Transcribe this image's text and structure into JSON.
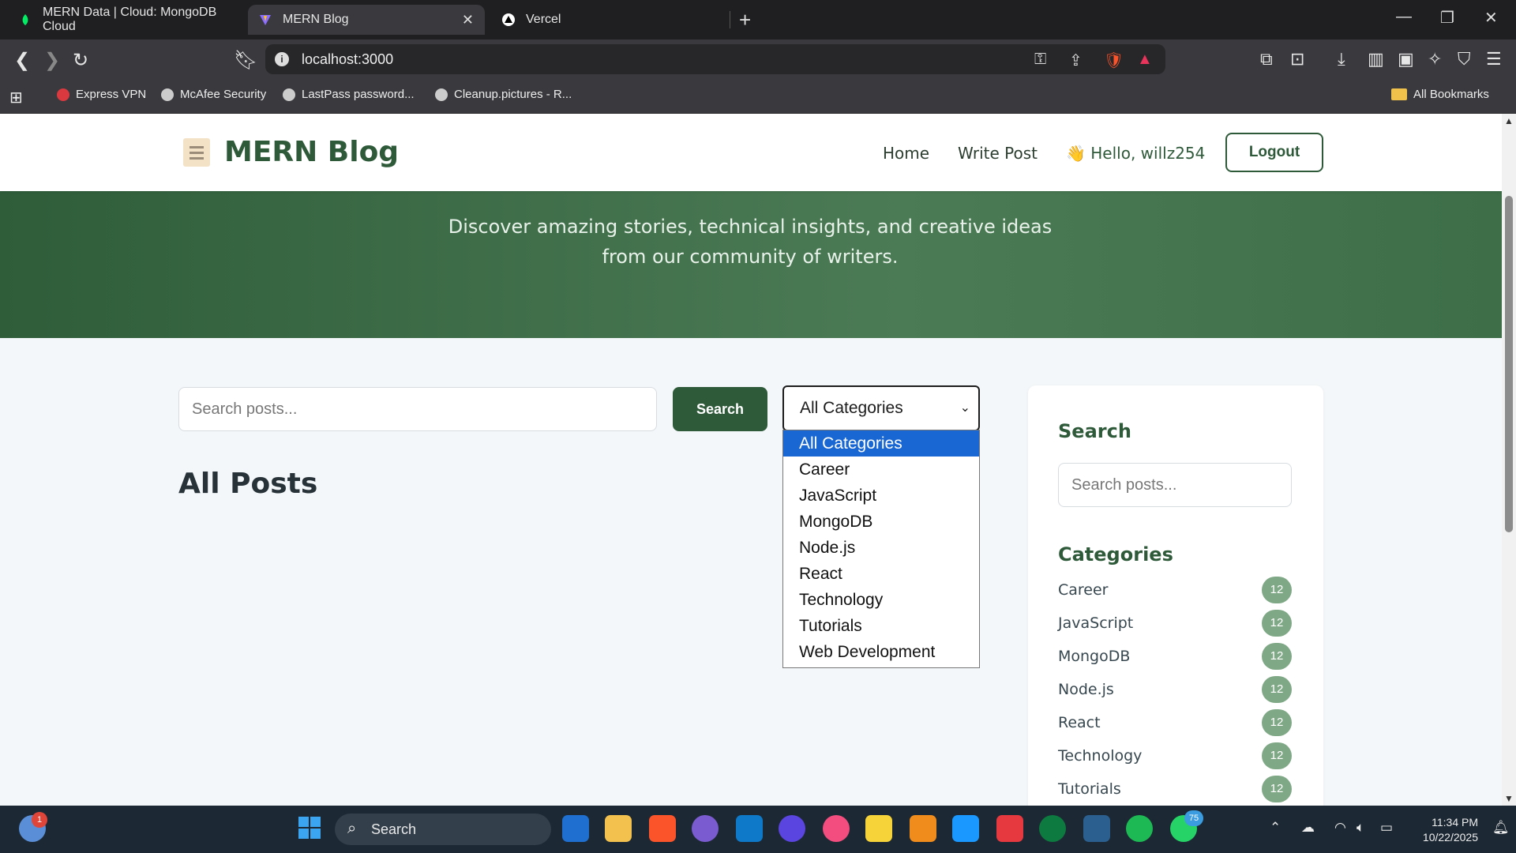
{
  "browser": {
    "tabs": [
      {
        "label": "MERN Data | Cloud: MongoDB Cloud",
        "color": "#00ed64"
      },
      {
        "label": "MERN Blog",
        "color": "#8a6cff"
      },
      {
        "label": "Vercel",
        "color": "#ffffff"
      }
    ],
    "new_tab_icon": "plus-icon",
    "address": "localhost:3000",
    "bookmarks": [
      "Express VPN",
      "McAfee Security",
      "LastPass password...",
      "Cleanup.pictures - R..."
    ],
    "all_bookmarks": "All Bookmarks"
  },
  "header": {
    "logo_title": "MERN Blog",
    "nav": {
      "home": "Home",
      "write": "Write Post"
    },
    "greeting": "👋 Hello, willz254",
    "logout": "Logout"
  },
  "hero": {
    "subtitle": "Discover amazing stories, technical insights, and creative ideas from our community of writers."
  },
  "filters": {
    "search_placeholder": "Search posts...",
    "search_button": "Search",
    "category_selected": "All Categories",
    "category_options": [
      "All Categories",
      "Career",
      "JavaScript",
      "MongoDB",
      "Node.js",
      "React",
      "Technology",
      "Tutorials",
      "Web Development"
    ]
  },
  "main": {
    "heading": "All Posts"
  },
  "sidebar": {
    "search_title": "Search",
    "search_placeholder": "Search posts...",
    "categories_title": "Categories",
    "categories": [
      {
        "name": "Career",
        "count": "12"
      },
      {
        "name": "JavaScript",
        "count": "12"
      },
      {
        "name": "MongoDB",
        "count": "12"
      },
      {
        "name": "Node.js",
        "count": "12"
      },
      {
        "name": "React",
        "count": "12"
      },
      {
        "name": "Technology",
        "count": "12"
      },
      {
        "name": "Tutorials",
        "count": "12"
      }
    ]
  },
  "taskbar": {
    "search_label": "Search",
    "weather_badge": "1",
    "whatsapp_badge": "75",
    "time": "11:34 PM",
    "date": "10/22/2025"
  },
  "colors": {
    "brand": "#2e5a3a",
    "hero": "#3d6e48",
    "badge": "#7fa886",
    "dropdown_highlight": "#1967d2"
  }
}
